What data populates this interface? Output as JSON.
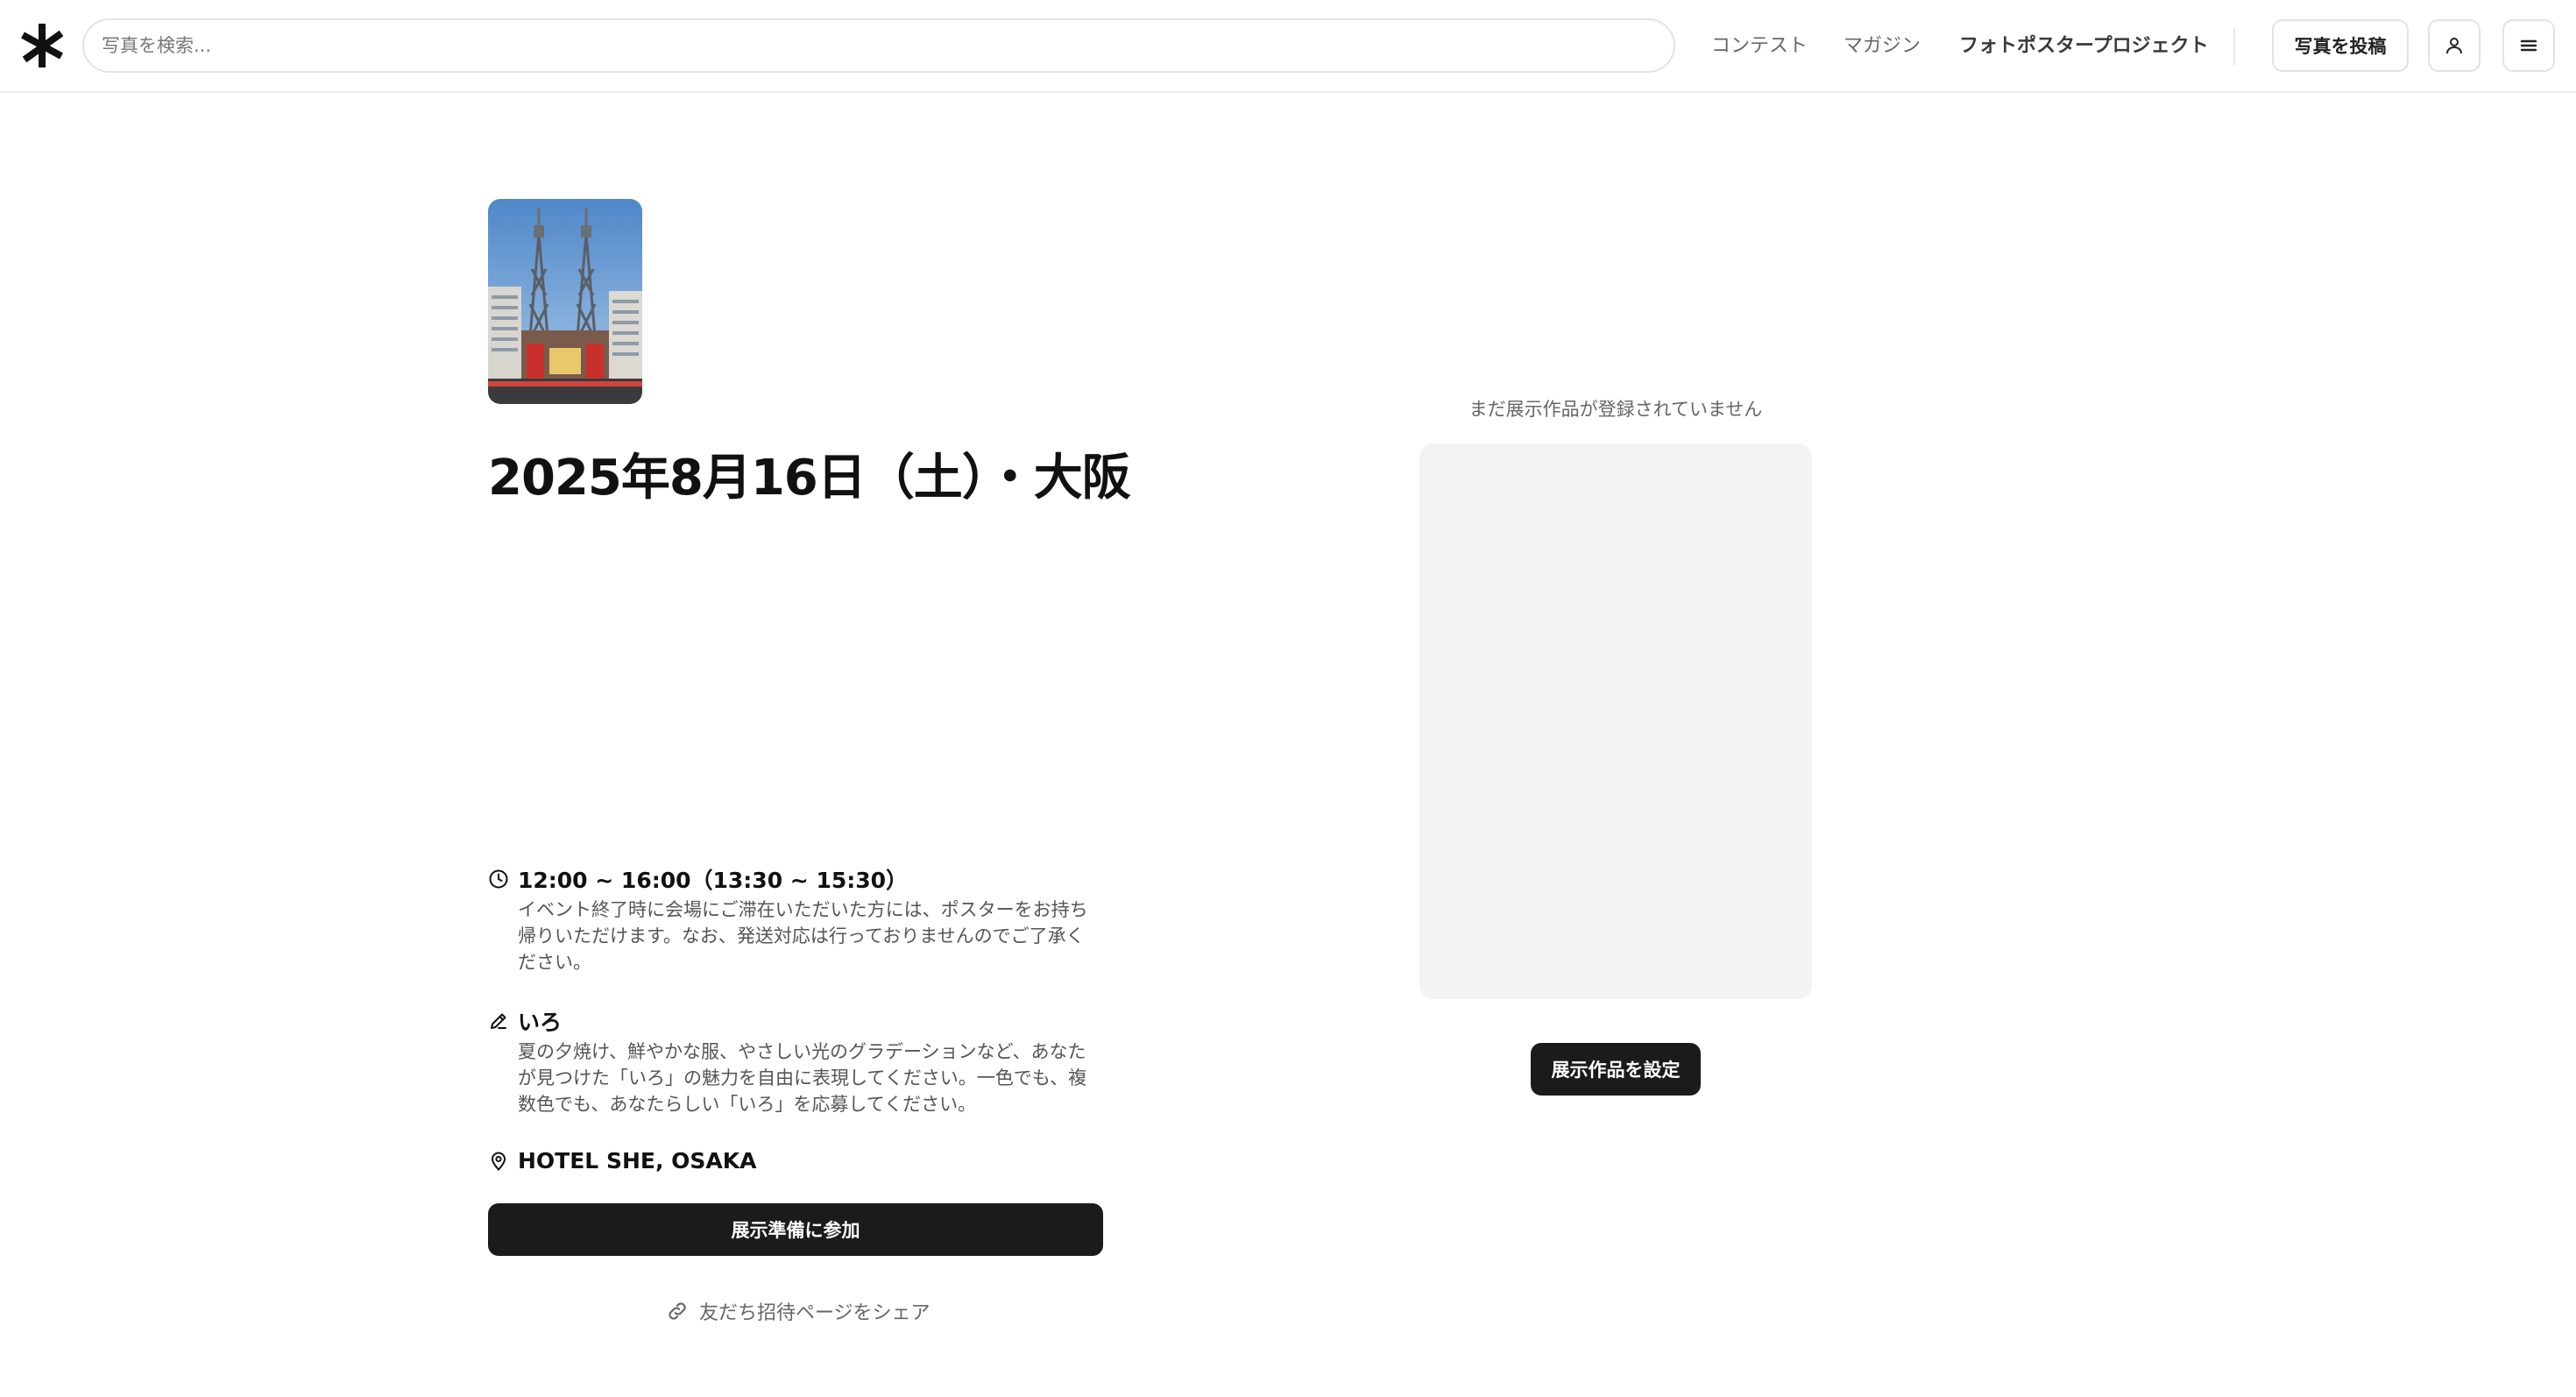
{
  "header": {
    "search_placeholder": "写真を検索...",
    "nav": {
      "contest": "コンテスト",
      "magazine": "マガジン",
      "project": "フォトポスタープロジェクト"
    },
    "upload_label": "写真を投稿",
    "user_icon": "user-icon",
    "menu_icon": "hamburger-menu-icon",
    "logo_icon": "asterisk-logo-icon"
  },
  "event": {
    "title": "2025年8月16日（土）・大阪",
    "time": {
      "icon": "clock-icon",
      "heading": "12:00 ~ 16:00（13:30 ~ 15:30）",
      "description": "イベント終了時に会場にご滞在いただいた方には、ポスターをお持ち帰りいただけます。なお、発送対応は行っておりませんのでご了承ください。"
    },
    "theme": {
      "icon": "pencil-icon",
      "heading": "いろ",
      "description": "夏の夕焼け、鮮やかな服、やさしい光のグラデーションなど、あなたが見つけた「いろ」の魅力を自由に表現してください。一色でも、複数色でも、あなたらしい「いろ」を応募してください。"
    },
    "venue": {
      "icon": "map-pin-icon",
      "heading": "HOTEL SHE, OSAKA"
    },
    "join_label": "展示準備に参加",
    "share": {
      "icon": "link-icon",
      "label": "友だち招待ページをシェア"
    }
  },
  "exhibit": {
    "empty_message": "まだ展示作品が登録されていません",
    "set_label": "展示作品を設定"
  },
  "colors": {
    "primary_button": "#1b1b1b",
    "placeholder_bg": "#f3f3f3",
    "border": "#e3e3e3"
  }
}
